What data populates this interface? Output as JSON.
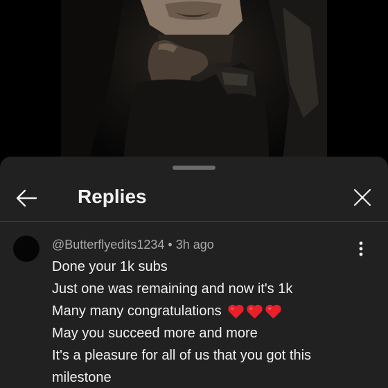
{
  "sheet": {
    "title": "Replies"
  },
  "comment": {
    "author": "@Butterflyedits1234",
    "separator": "•",
    "time": "3h ago",
    "lines": [
      "Done your 1k subs",
      "Just one was remaining and now it's 1k",
      "Many many congratulations",
      "May you succeed more and more",
      "It's a pleasure for all of us that you got this",
      "milestone"
    ],
    "emoji": [
      "red-heart",
      "red-heart",
      "red-heart"
    ]
  },
  "icons": {
    "back": "arrow-left-icon",
    "close": "close-icon",
    "more": "more-vertical-icon"
  },
  "colors": {
    "sheet_background": "#212121",
    "text_primary": "#f1f1f1",
    "text_secondary": "#aaaaaa",
    "heart": "#e8202a"
  }
}
